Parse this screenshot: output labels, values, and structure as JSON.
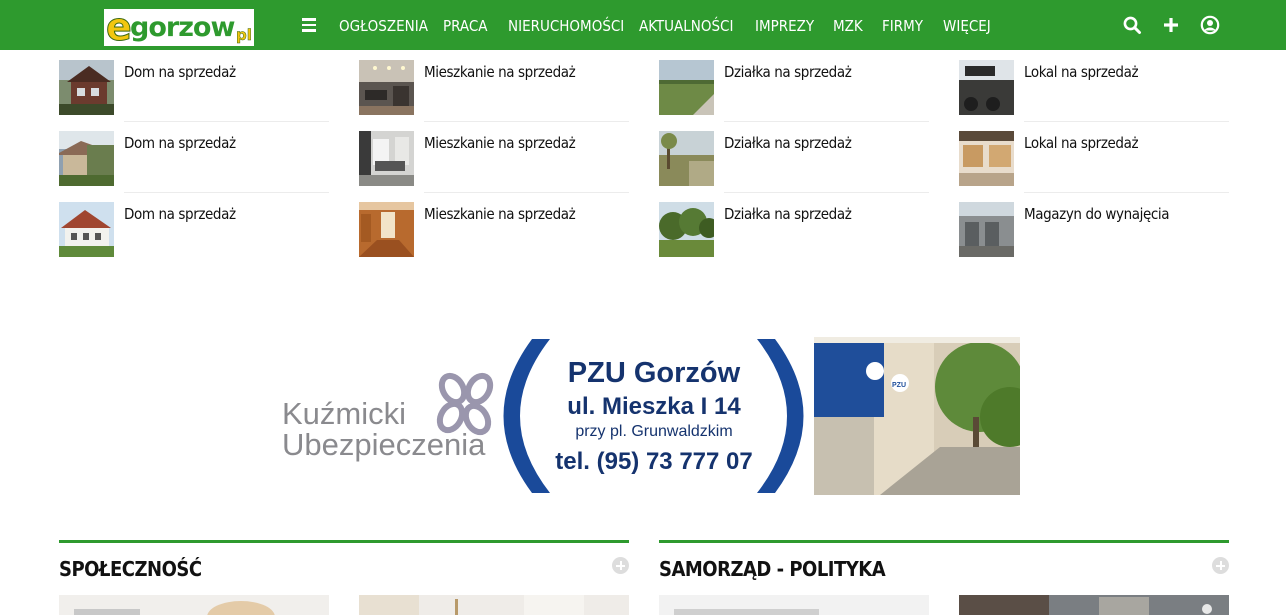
{
  "nav": {
    "logo": {
      "e": "e",
      "main": "gorzow",
      "tld": "pl"
    },
    "menu_icon": "hamburger-icon",
    "items": [
      "OGŁOSZENIA",
      "PRACA",
      "NIERUCHOMOŚCI",
      "AKTUALNOŚCI",
      "IMPREZY",
      "MZK",
      "FIRMY",
      "WIĘCEJ"
    ],
    "icons": [
      "search-icon",
      "plus-icon",
      "user-icon"
    ],
    "colors": {
      "bar": "#2e9a2e",
      "logo_yellow": "#f2c60f"
    }
  },
  "listings": [
    {
      "items": [
        "Dom na sprzedaż",
        "Dom na sprzedaż",
        "Dom na sprzedaż"
      ]
    },
    {
      "items": [
        "Mieszkanie na sprzedaż",
        "Mieszkanie na sprzedaż",
        "Mieszkanie na sprzedaż"
      ]
    },
    {
      "items": [
        "Działka na sprzedaż",
        "Działka na sprzedaż",
        "Działka na sprzedaż"
      ]
    },
    {
      "items": [
        "Lokal na sprzedaż",
        "Lokal na sprzedaż",
        "Magazyn do wynajęcia"
      ]
    }
  ],
  "ad": {
    "brand_line1": "Kuźmicki",
    "brand_line2": "Ubezpieczenia",
    "headline": "PZU Gorzów",
    "address": "ul. Mieszka I 14",
    "near": "przy pl. Grunwaldzkim",
    "phone": "tel. (95) 73 777 07",
    "sign": "PZU"
  },
  "sections": [
    "SPOŁECZNOŚĆ",
    "SAMORZĄD - POLITYKA"
  ]
}
